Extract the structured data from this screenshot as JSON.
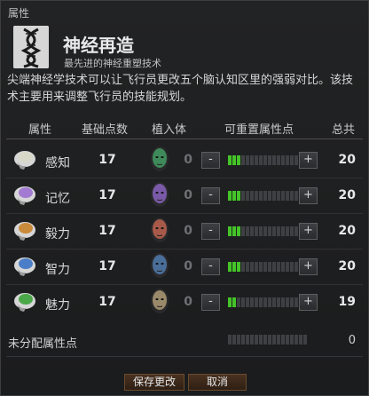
{
  "window": {
    "title": "属性"
  },
  "header": {
    "icon": "dna-helix-icon",
    "title": "神经再造",
    "subtitle": "最先进的神经重塑技术"
  },
  "description": "尖端神经学技术可以让飞行员更改五个脑认知区里的强弱对比。该技术主要用来调整飞行员的技能规划。",
  "columns": {
    "attribute": "属性",
    "base": "基础点数",
    "implant": "植入体",
    "remappable": "可重置属性点",
    "total": "总共"
  },
  "attributes": [
    {
      "name": "感知",
      "base": "17",
      "implant": "0",
      "total": "20",
      "filled": 3,
      "segments": 18,
      "brain_color": "#d8d8c8",
      "implant_color": "#3f8a5a",
      "icon": "brain-perception-icon"
    },
    {
      "name": "记忆",
      "base": "17",
      "implant": "0",
      "total": "20",
      "filled": 3,
      "segments": 18,
      "brain_color": "#a37ad2",
      "implant_color": "#7a5aa8",
      "icon": "brain-memory-icon"
    },
    {
      "name": "毅力",
      "base": "17",
      "implant": "0",
      "total": "20",
      "filled": 3,
      "segments": 18,
      "brain_color": "#c98a3a",
      "implant_color": "#a85a4a",
      "icon": "brain-willpower-icon"
    },
    {
      "name": "智力",
      "base": "17",
      "implant": "0",
      "total": "20",
      "filled": 3,
      "segments": 18,
      "brain_color": "#4a7ec8",
      "implant_color": "#4a6e9a",
      "icon": "brain-intelligence-icon"
    },
    {
      "name": "魅力",
      "base": "17",
      "implant": "0",
      "total": "19",
      "filled": 2,
      "segments": 18,
      "brain_color": "#4aa848",
      "implant_color": "#9a8a6a",
      "icon": "brain-charisma-icon"
    }
  ],
  "buttons": {
    "minus": "-",
    "plus": "+"
  },
  "unallocated": {
    "label": "未分配属性点",
    "value": "0",
    "segments": 18
  },
  "footer": {
    "save": "保存更改",
    "cancel": "取消"
  },
  "colors": {
    "bar_on": "#44c428",
    "bar_off": "#3e4043",
    "accent_button": "#4a3220"
  }
}
